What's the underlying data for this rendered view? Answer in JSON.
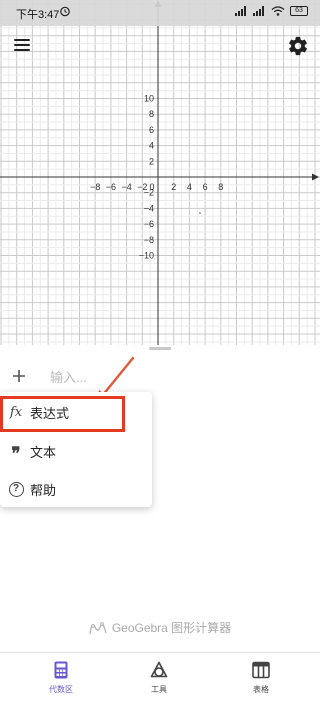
{
  "status_bar": {
    "time": "下午3:47",
    "battery": "63"
  },
  "graph": {
    "x_ticks": [
      "−8",
      "−6",
      "−4",
      "−2",
      "0",
      "2",
      "4",
      "6",
      "8"
    ],
    "y_ticks": [
      "10",
      "8",
      "6",
      "4",
      "2",
      "−2",
      "−4",
      "−6",
      "−8",
      "−10"
    ]
  },
  "algebra": {
    "input_placeholder": "输入..."
  },
  "popup_menu": {
    "items": [
      {
        "icon": "function-icon",
        "label": "表达式"
      },
      {
        "icon": "quote-icon",
        "label": "文本"
      },
      {
        "icon": "help-icon",
        "label": "帮助"
      }
    ]
  },
  "brand": {
    "text": "GeoGebra 图形计算器"
  },
  "bottom_nav": {
    "tabs": [
      {
        "icon": "calculator-icon",
        "label": "代数区",
        "active": true
      },
      {
        "icon": "tools-icon",
        "label": "工具",
        "active": false
      },
      {
        "icon": "table-icon",
        "label": "表格",
        "active": false
      }
    ]
  },
  "colors": {
    "accent": "#6557d2",
    "highlight": "#e53a22",
    "arrow": "#e05a3a"
  }
}
